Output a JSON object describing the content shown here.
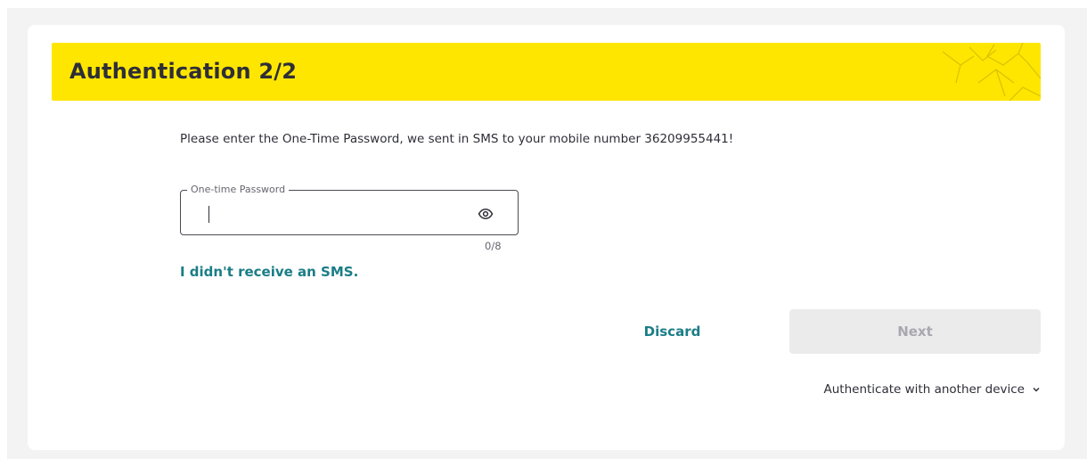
{
  "header": {
    "title": "Authentication 2/2",
    "background_color": "#ffe600"
  },
  "instruction": "Please enter the One-Time Password, we sent in SMS to your mobile number 36209955441!",
  "otp": {
    "label": "One-time Password",
    "value": "",
    "counter": "0/8",
    "toggle_icon": "eye-icon"
  },
  "links": {
    "no_sms": "I didn't receive an SMS."
  },
  "actions": {
    "discard_label": "Discard",
    "next_label": "Next",
    "next_enabled": false
  },
  "alt_auth": {
    "label": "Authenticate with another device",
    "icon": "chevron-down-icon"
  },
  "colors": {
    "accent_teal": "#1a7d86",
    "brand_yellow": "#ffe600",
    "text_dark": "#2e2e38",
    "disabled_bg": "#ebebeb",
    "disabled_text": "#a8a8b0"
  }
}
